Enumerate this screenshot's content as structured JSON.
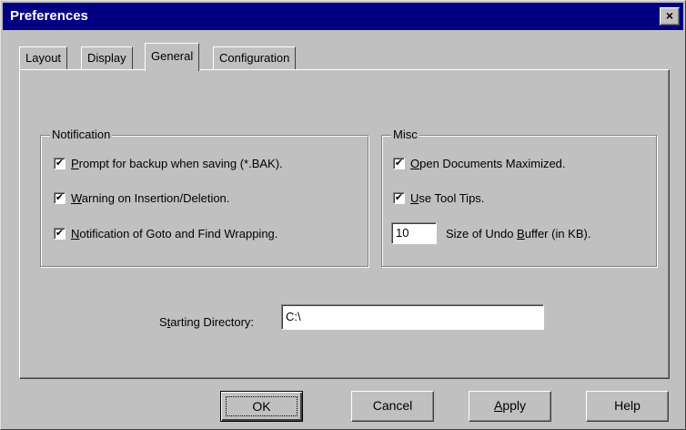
{
  "window": {
    "title": "Preferences",
    "close_glyph": "×"
  },
  "tabs": [
    {
      "label": "Layout",
      "active": false
    },
    {
      "label": "Display",
      "active": false
    },
    {
      "label": "General",
      "active": true
    },
    {
      "label": "Configuration",
      "active": false
    }
  ],
  "notification": {
    "legend": "Notification",
    "items": [
      {
        "mnemonic": "P",
        "rest": "rompt for backup when saving (*.BAK).",
        "checked": true
      },
      {
        "mnemonic": "W",
        "rest": "arning on Insertion/Deletion.",
        "checked": true
      },
      {
        "mnemonic": "N",
        "rest": "otification of Goto and Find Wrapping.",
        "checked": true
      }
    ]
  },
  "misc": {
    "legend": "Misc",
    "items": [
      {
        "mnemonic": "O",
        "rest": "pen Documents Maximized.",
        "checked": true
      },
      {
        "mnemonic": "U",
        "rest": "se Tool Tips.",
        "checked": true
      }
    ],
    "undo_buffer_value": "10",
    "undo_label_prefix": "Size of Undo ",
    "undo_label_mnemonic": "B",
    "undo_label_suffix": "uffer (in KB)."
  },
  "starting_directory": {
    "label_prefix": "S",
    "label_mnemonic": "t",
    "label_suffix": "arting Directory:",
    "value": "C:\\"
  },
  "buttons": {
    "ok": "OK",
    "cancel": "Cancel",
    "apply_mnemonic": "A",
    "apply_rest": "pply",
    "help": "Help"
  },
  "check_glyph": "✔"
}
